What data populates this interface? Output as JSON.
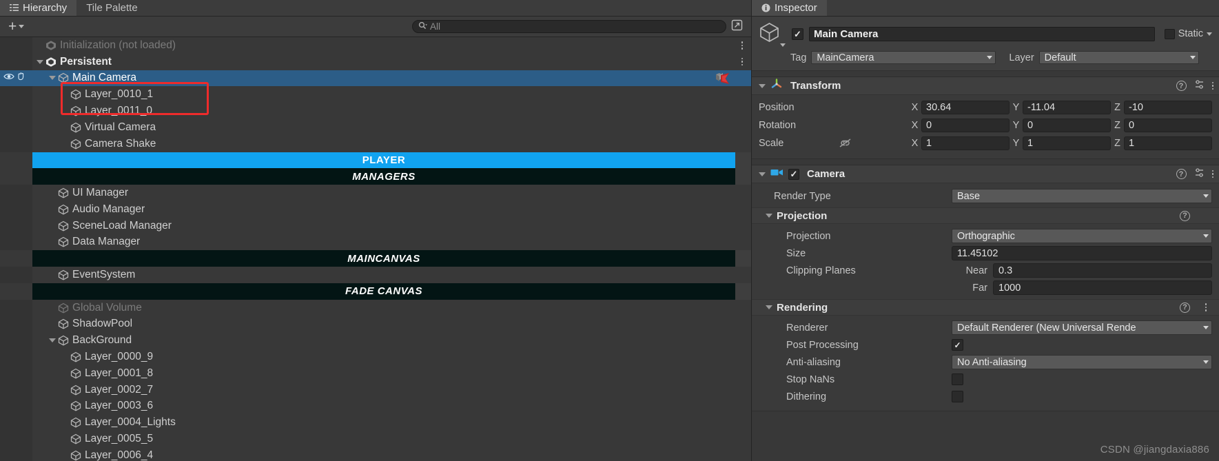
{
  "hierarchy": {
    "tabs": [
      {
        "label": "Hierarchy",
        "icon": "hierarchy-icon",
        "active": true
      },
      {
        "label": "Tile Palette",
        "icon": "",
        "active": false
      }
    ],
    "toolbar": {
      "add_label": "+",
      "search_placeholder": "All",
      "search_icon": "search-icon",
      "popout_icon": "popout-window-icon"
    },
    "rows": [
      {
        "label": "Initialization (not loaded)",
        "indent": 1,
        "type": "scene",
        "state": "dim",
        "fold": "none",
        "menu": true
      },
      {
        "label": "Persistent",
        "indent": 1,
        "type": "scene",
        "state": "bold",
        "fold": "down",
        "menu": true
      },
      {
        "label": "Main Camera",
        "indent": 2,
        "type": "go",
        "state": "selected",
        "fold": "down",
        "visibility": true,
        "prefab": true
      },
      {
        "label": "Layer_0010_1",
        "indent": 3,
        "type": "go",
        "state": "normal",
        "fold": "none"
      },
      {
        "label": "Layer_0011_0",
        "indent": 3,
        "type": "go",
        "state": "normal",
        "fold": "none"
      },
      {
        "label": "Virtual Camera",
        "indent": 3,
        "type": "go",
        "state": "normal",
        "fold": "none"
      },
      {
        "label": "Camera Shake",
        "indent": 3,
        "type": "go",
        "state": "normal",
        "fold": "none"
      },
      {
        "label": "PLAYER",
        "indent": 2,
        "type": "banner",
        "banner": "blue",
        "fold": "right"
      },
      {
        "label": "MANAGERS",
        "indent": 2,
        "type": "banner",
        "banner": "dark",
        "fold": "none"
      },
      {
        "label": "UI Manager",
        "indent": 2,
        "type": "go",
        "state": "normal",
        "fold": "none"
      },
      {
        "label": "Audio Manager",
        "indent": 2,
        "type": "go",
        "state": "normal",
        "fold": "none"
      },
      {
        "label": "SceneLoad Manager",
        "indent": 2,
        "type": "go",
        "state": "normal",
        "fold": "none"
      },
      {
        "label": "Data Manager",
        "indent": 2,
        "type": "go",
        "state": "normal",
        "fold": "none"
      },
      {
        "label": "MAINCANVAS",
        "indent": 2,
        "type": "banner",
        "banner": "dark",
        "fold": "right"
      },
      {
        "label": "EventSystem",
        "indent": 2,
        "type": "go",
        "state": "normal",
        "fold": "none"
      },
      {
        "label": "FADE CANVAS",
        "indent": 2,
        "type": "banner",
        "banner": "dark",
        "fold": "right"
      },
      {
        "label": "Global Volume",
        "indent": 2,
        "type": "go",
        "state": "dim",
        "fold": "none"
      },
      {
        "label": "ShadowPool",
        "indent": 2,
        "type": "go",
        "state": "normal",
        "fold": "none"
      },
      {
        "label": "BackGround",
        "indent": 2,
        "type": "go",
        "state": "normal",
        "fold": "down"
      },
      {
        "label": "Layer_0000_9",
        "indent": 3,
        "type": "go",
        "state": "normal",
        "fold": "none"
      },
      {
        "label": "Layer_0001_8",
        "indent": 3,
        "type": "go",
        "state": "normal",
        "fold": "none"
      },
      {
        "label": "Layer_0002_7",
        "indent": 3,
        "type": "go",
        "state": "normal",
        "fold": "none"
      },
      {
        "label": "Layer_0003_6",
        "indent": 3,
        "type": "go",
        "state": "normal",
        "fold": "none"
      },
      {
        "label": "Layer_0004_Lights",
        "indent": 3,
        "type": "go",
        "state": "normal",
        "fold": "none"
      },
      {
        "label": "Layer_0005_5",
        "indent": 3,
        "type": "go",
        "state": "normal",
        "fold": "none"
      },
      {
        "label": "Layer_0006_4",
        "indent": 3,
        "type": "go",
        "state": "normal",
        "fold": "none"
      }
    ],
    "annotation": {
      "shape": "rectangle",
      "color": "#ee2b2b",
      "targets": [
        "Layer_0010_1",
        "Layer_0011_0"
      ]
    }
  },
  "inspector": {
    "tab": {
      "label": "Inspector",
      "icon": "info-icon"
    },
    "header": {
      "enabled_checked": true,
      "name": "Main Camera",
      "static_label": "Static",
      "tag_label": "Tag",
      "tag_value": "MainCamera",
      "layer_label": "Layer",
      "layer_value": "Default"
    },
    "transform": {
      "title": "Transform",
      "icon": "transform-axis-icon",
      "rows": [
        {
          "label": "Position",
          "x": "30.64",
          "y": "-11.04",
          "z": "-10"
        },
        {
          "label": "Rotation",
          "x": "0",
          "y": "0",
          "z": "0"
        },
        {
          "label": "Scale",
          "x": "1",
          "y": "1",
          "z": "1",
          "link": true
        }
      ],
      "axis_labels": [
        "X",
        "Y",
        "Z"
      ]
    },
    "camera": {
      "title": "Camera",
      "icon": "camera-icon",
      "enabled_checked": true,
      "render_type_label": "Render Type",
      "render_type_value": "Base",
      "projection": {
        "section_label": "Projection",
        "projection_label": "Projection",
        "projection_value": "Orthographic",
        "size_label": "Size",
        "size_value": "11.45102",
        "clipping_label": "Clipping Planes",
        "near_label": "Near",
        "near_value": "0.3",
        "far_label": "Far",
        "far_value": "1000"
      },
      "rendering": {
        "section_label": "Rendering",
        "renderer_label": "Renderer",
        "renderer_value": "Default Renderer (New Universal Rende",
        "post_processing_label": "Post Processing",
        "post_processing_checked": true,
        "anti_aliasing_label": "Anti-aliasing",
        "anti_aliasing_value": "No Anti-aliasing",
        "stop_nans_label": "Stop NaNs",
        "stop_nans_checked": false,
        "dithering_label": "Dithering",
        "dithering_checked": false
      }
    }
  },
  "watermark": "CSDN @jiangdaxia886",
  "colors": {
    "accent_blue": "#11a3f0",
    "selection_blue": "#2c5d87",
    "banner_dark": "#031514",
    "annotation_red": "#ee2b2b",
    "panel_bg": "#383838"
  }
}
